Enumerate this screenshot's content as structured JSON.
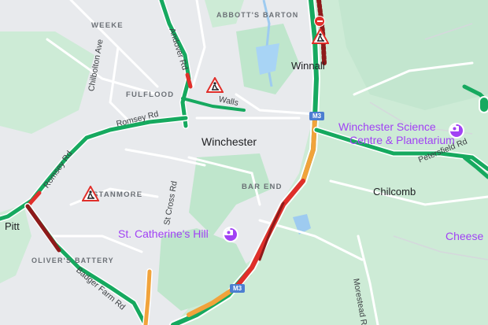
{
  "map": {
    "areas": {
      "weeke": "WEEKE",
      "abbotts_barton": "ABBOTT'S BARTON",
      "fulflood": "FULFLOOD",
      "stanmore": "STANMORE",
      "olivers_battery": "OLIVER'S BATTERY",
      "bar_end": "BAR END"
    },
    "places": {
      "winchester": "Winchester",
      "winnall": "Winnall",
      "chilcomb": "Chilcomb",
      "pitt": "Pitt",
      "cheese": "Cheese"
    },
    "roads": {
      "andover_rd": "Andover Rd",
      "chilbolton_ave": "Chilbolton Ave",
      "romsey_rd": "Romsey Rd",
      "romsey_rd_2": "Romsey Rd",
      "st_cross_rd": "St Cross Rd",
      "badger_farm_rd": "Badger Farm Rd",
      "petersfield_rd": "Petersfield Rd",
      "morestead_rd": "Morestead Rd",
      "walls": "Walls"
    },
    "shields": {
      "m3_top": "M3",
      "m3_bottom": "M3"
    },
    "pois": {
      "science_centre_line1": "Winchester Science",
      "science_centre_line2": "Centre & Planetarium",
      "st_catherines_hill": "St. Catherine's Hill"
    },
    "icons": [
      "roadworks-icon",
      "camera-icon",
      "no-entry-icon"
    ],
    "colors": {
      "traffic_green": "#16a95f",
      "traffic_orange": "#f1a33b",
      "traffic_red": "#e02f2a",
      "traffic_darkred": "#8e1a1a",
      "poi_purple": "#a142f4",
      "park_green": "#bfe6cc"
    }
  }
}
